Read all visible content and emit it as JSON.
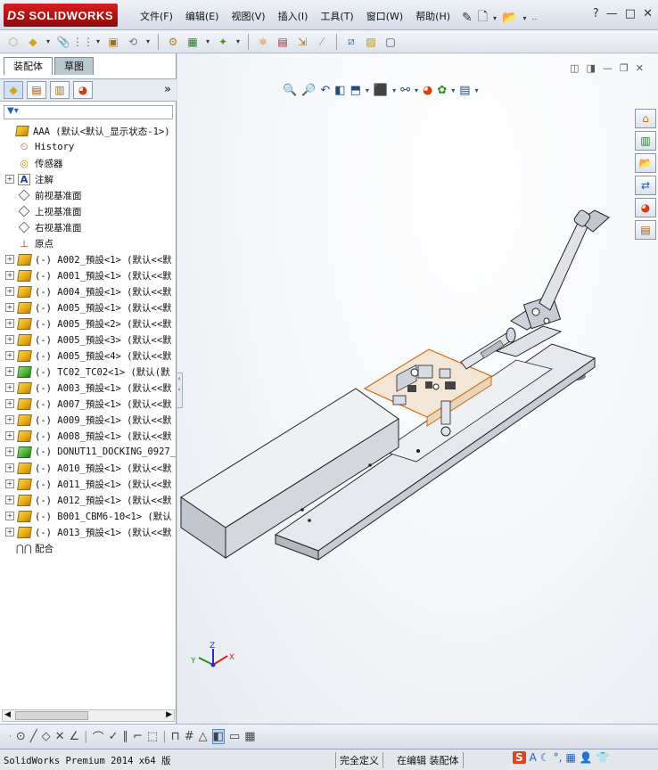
{
  "app": {
    "logo_prefix": "DS",
    "logo_text": "SOLIDWORKS"
  },
  "menu": [
    "文件(F)",
    "编辑(E)",
    "视图(V)",
    "插入(I)",
    "工具(T)",
    "窗口(W)",
    "帮助(H)"
  ],
  "window_controls": [
    "?",
    "—",
    "□",
    "✕"
  ],
  "left_panel": {
    "tabs": [
      "装配体",
      "草图"
    ],
    "filter_icon": "funnel-icon",
    "chevron": "»",
    "tree": [
      {
        "label": "AAA  (默认<默认_显示状态-1>)",
        "icon": "assembly-icon",
        "expand": "-",
        "indent": 0
      },
      {
        "label": "History",
        "icon": "history-icon",
        "expand": "",
        "indent": 1
      },
      {
        "label": "传感器",
        "icon": "sensor-icon",
        "expand": "",
        "indent": 1
      },
      {
        "label": "注解",
        "icon": "annotation-icon",
        "expand": "+",
        "indent": 1
      },
      {
        "label": "前视基准面",
        "icon": "plane-icon",
        "expand": "",
        "indent": 1
      },
      {
        "label": "上视基准面",
        "icon": "plane-icon",
        "expand": "",
        "indent": 1
      },
      {
        "label": "右视基准面",
        "icon": "plane-icon",
        "expand": "",
        "indent": 1
      },
      {
        "label": "原点",
        "icon": "origin-icon",
        "expand": "",
        "indent": 1
      },
      {
        "label": "(-) A002_預設<1> (默认<<默",
        "icon": "part-icon",
        "expand": "+",
        "indent": 1
      },
      {
        "label": "(-) A001_預設<1> (默认<<默",
        "icon": "part-icon",
        "expand": "+",
        "indent": 1
      },
      {
        "label": "(-) A004_預設<1> (默认<<默",
        "icon": "part-icon",
        "expand": "+",
        "indent": 1
      },
      {
        "label": "(-) A005_預設<1> (默认<<默",
        "icon": "part-icon",
        "expand": "+",
        "indent": 1
      },
      {
        "label": "(-) A005_預設<2> (默认<<默",
        "icon": "part-icon",
        "expand": "+",
        "indent": 1
      },
      {
        "label": "(-) A005_預設<3> (默认<<默",
        "icon": "part-icon",
        "expand": "+",
        "indent": 1
      },
      {
        "label": "(-) A005_預設<4> (默认<<默",
        "icon": "part-icon",
        "expand": "+",
        "indent": 1
      },
      {
        "label": "(-) TC02_TC02<1> (默认(默",
        "icon": "subassembly-icon",
        "expand": "+",
        "indent": 1
      },
      {
        "label": "(-) A003_預設<1> (默认<<默",
        "icon": "part-icon",
        "expand": "+",
        "indent": 1
      },
      {
        "label": "(-) A007_預設<1> (默认<<默",
        "icon": "part-icon",
        "expand": "+",
        "indent": 1
      },
      {
        "label": "(-) A009_預設<1> (默认<<默",
        "icon": "part-icon",
        "expand": "+",
        "indent": 1
      },
      {
        "label": "(-) A008_預設<1> (默认<<默",
        "icon": "part-icon",
        "expand": "+",
        "indent": 1
      },
      {
        "label": "(-) DONUT11_DOCKING_0927_",
        "icon": "subassembly-icon",
        "expand": "+",
        "indent": 1
      },
      {
        "label": "(-) A010_預設<1> (默认<<默",
        "icon": "part-icon",
        "expand": "+",
        "indent": 1
      },
      {
        "label": "(-) A011_預設<1> (默认<<默",
        "icon": "part-icon",
        "expand": "+",
        "indent": 1
      },
      {
        "label": "(-) A012_預設<1> (默认<<默",
        "icon": "part-icon",
        "expand": "+",
        "indent": 1
      },
      {
        "label": "(-) B001_CBM6-10<1> (默认",
        "icon": "part-icon",
        "expand": "+",
        "indent": 1
      },
      {
        "label": "(-) A013_預設<1> (默认<<默",
        "icon": "part-icon",
        "expand": "+",
        "indent": 1
      },
      {
        "label": "配合",
        "icon": "mates-icon",
        "expand": "",
        "indent": 1
      }
    ]
  },
  "triad": {
    "x": "X",
    "y": "Y",
    "z": "Z"
  },
  "status": {
    "product": "SolidWorks Premium 2014 x64 版",
    "definition": "完全定义",
    "editing": "在编辑 装配体"
  },
  "ime": {
    "s": "S",
    "a": "A"
  },
  "colors": {
    "accent": "#1d5fbf",
    "brand": "#c81414",
    "viewport_bg": "#f4f6f9"
  }
}
